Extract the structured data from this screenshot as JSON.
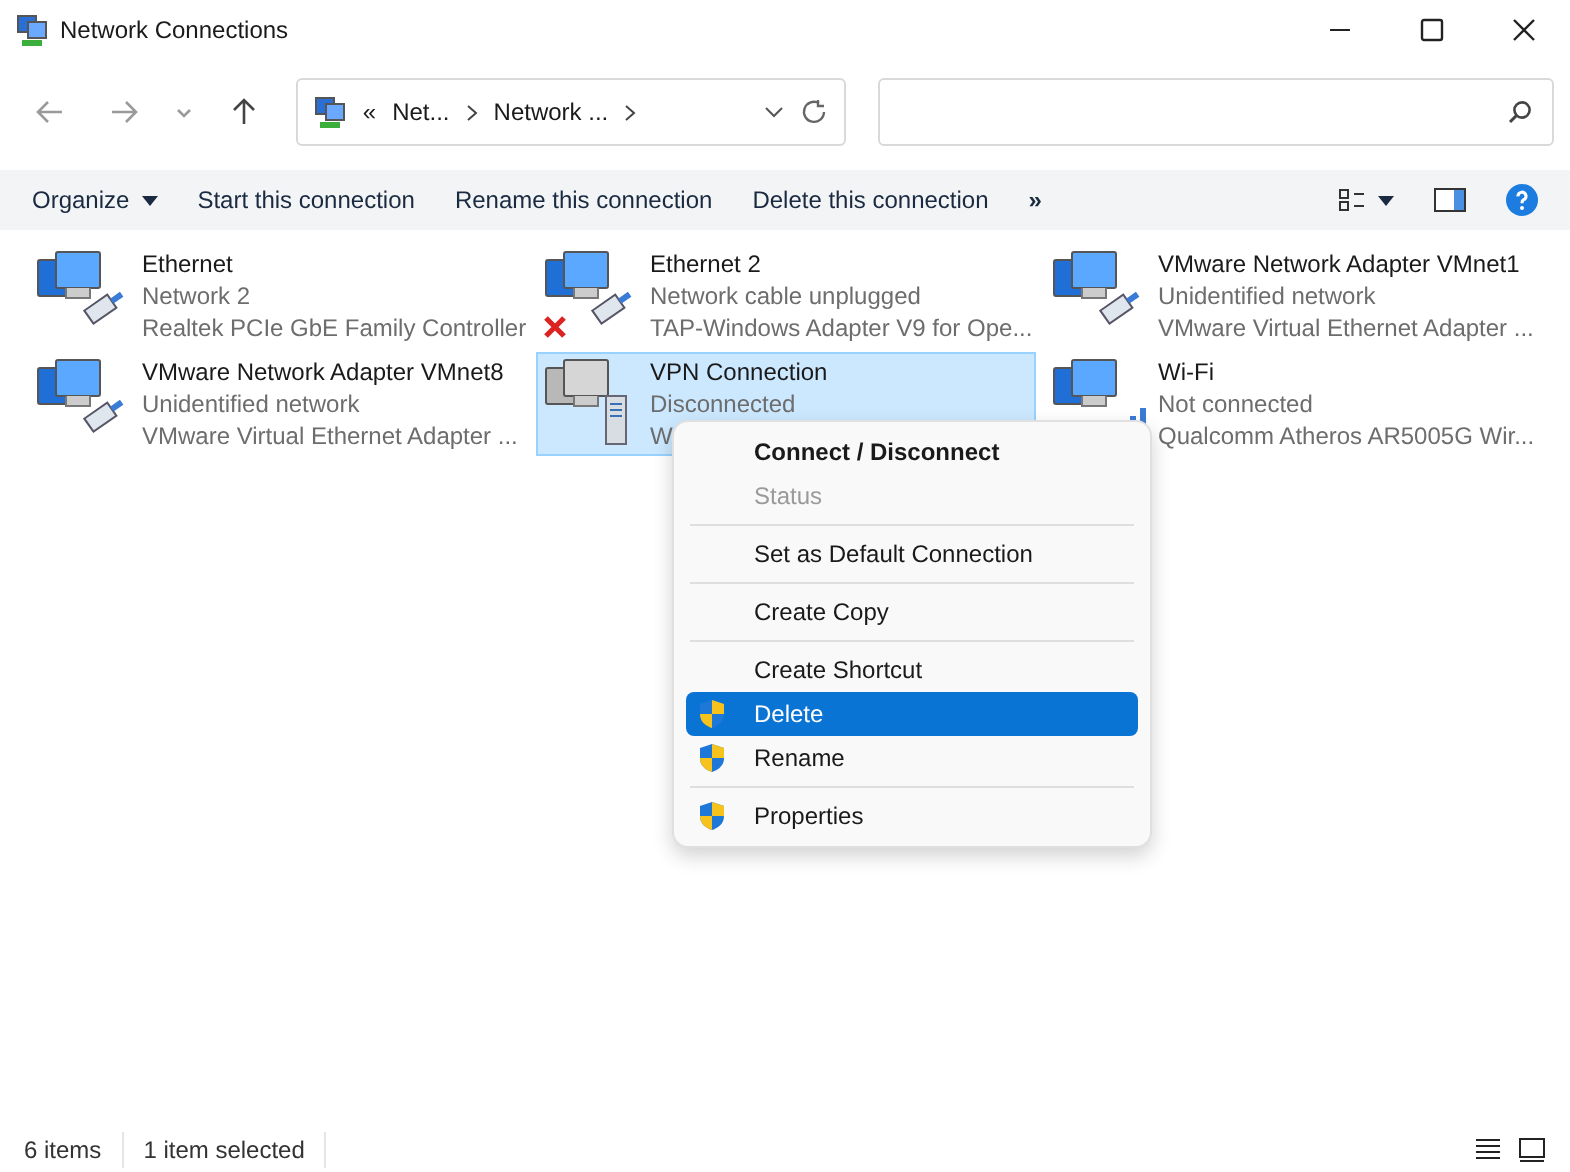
{
  "window": {
    "title": "Network Connections"
  },
  "address": {
    "overflow": "«",
    "crumbs": [
      "Net...",
      "Network ..."
    ]
  },
  "toolbar": {
    "items": [
      {
        "label": "Organize",
        "dropdown": true
      },
      {
        "label": "Start this connection",
        "dropdown": false
      },
      {
        "label": "Rename this connection",
        "dropdown": false
      },
      {
        "label": "Delete this connection",
        "dropdown": false
      }
    ],
    "more": "»"
  },
  "connections": [
    {
      "name": "Ethernet",
      "status": "Network 2",
      "device": "Realtek PCIe GbE Family Controller",
      "kind": "ethernet",
      "unplugged": false,
      "selected": false
    },
    {
      "name": "Ethernet 2",
      "status": "Network cable unplugged",
      "device": "TAP-Windows Adapter V9 for Ope...",
      "kind": "ethernet",
      "unplugged": true,
      "selected": false
    },
    {
      "name": "VMware Network Adapter VMnet1",
      "status": "Unidentified network",
      "device": "VMware Virtual Ethernet Adapter ...",
      "kind": "ethernet",
      "unplugged": false,
      "selected": false
    },
    {
      "name": "VMware Network Adapter VMnet8",
      "status": "Unidentified network",
      "device": "VMware Virtual Ethernet Adapter ...",
      "kind": "ethernet",
      "unplugged": false,
      "selected": false
    },
    {
      "name": "VPN Connection",
      "status": "Disconnected",
      "device": "W",
      "kind": "vpn",
      "unplugged": false,
      "selected": true
    },
    {
      "name": "Wi-Fi",
      "status": "Not connected",
      "device": "Qualcomm Atheros AR5005G Wir...",
      "kind": "wifi",
      "unplugged": false,
      "selected": false
    }
  ],
  "context_menu": [
    {
      "kind": "item",
      "label": "Connect / Disconnect",
      "default": true,
      "disabled": false,
      "selected": false,
      "shield": false
    },
    {
      "kind": "item",
      "label": "Status",
      "default": false,
      "disabled": true,
      "selected": false,
      "shield": false
    },
    {
      "kind": "separator"
    },
    {
      "kind": "item",
      "label": "Set as Default Connection",
      "default": false,
      "disabled": false,
      "selected": false,
      "shield": false
    },
    {
      "kind": "separator"
    },
    {
      "kind": "item",
      "label": "Create Copy",
      "default": false,
      "disabled": false,
      "selected": false,
      "shield": false
    },
    {
      "kind": "separator"
    },
    {
      "kind": "item",
      "label": "Create Shortcut",
      "default": false,
      "disabled": false,
      "selected": false,
      "shield": false
    },
    {
      "kind": "item",
      "label": "Delete",
      "default": false,
      "disabled": false,
      "selected": true,
      "shield": true
    },
    {
      "kind": "item",
      "label": "Rename",
      "default": false,
      "disabled": false,
      "selected": false,
      "shield": true
    },
    {
      "kind": "separator"
    },
    {
      "kind": "item",
      "label": "Properties",
      "default": false,
      "disabled": false,
      "selected": false,
      "shield": true
    }
  ],
  "status_bar": {
    "count": "6 items",
    "selection": "1 item selected"
  }
}
